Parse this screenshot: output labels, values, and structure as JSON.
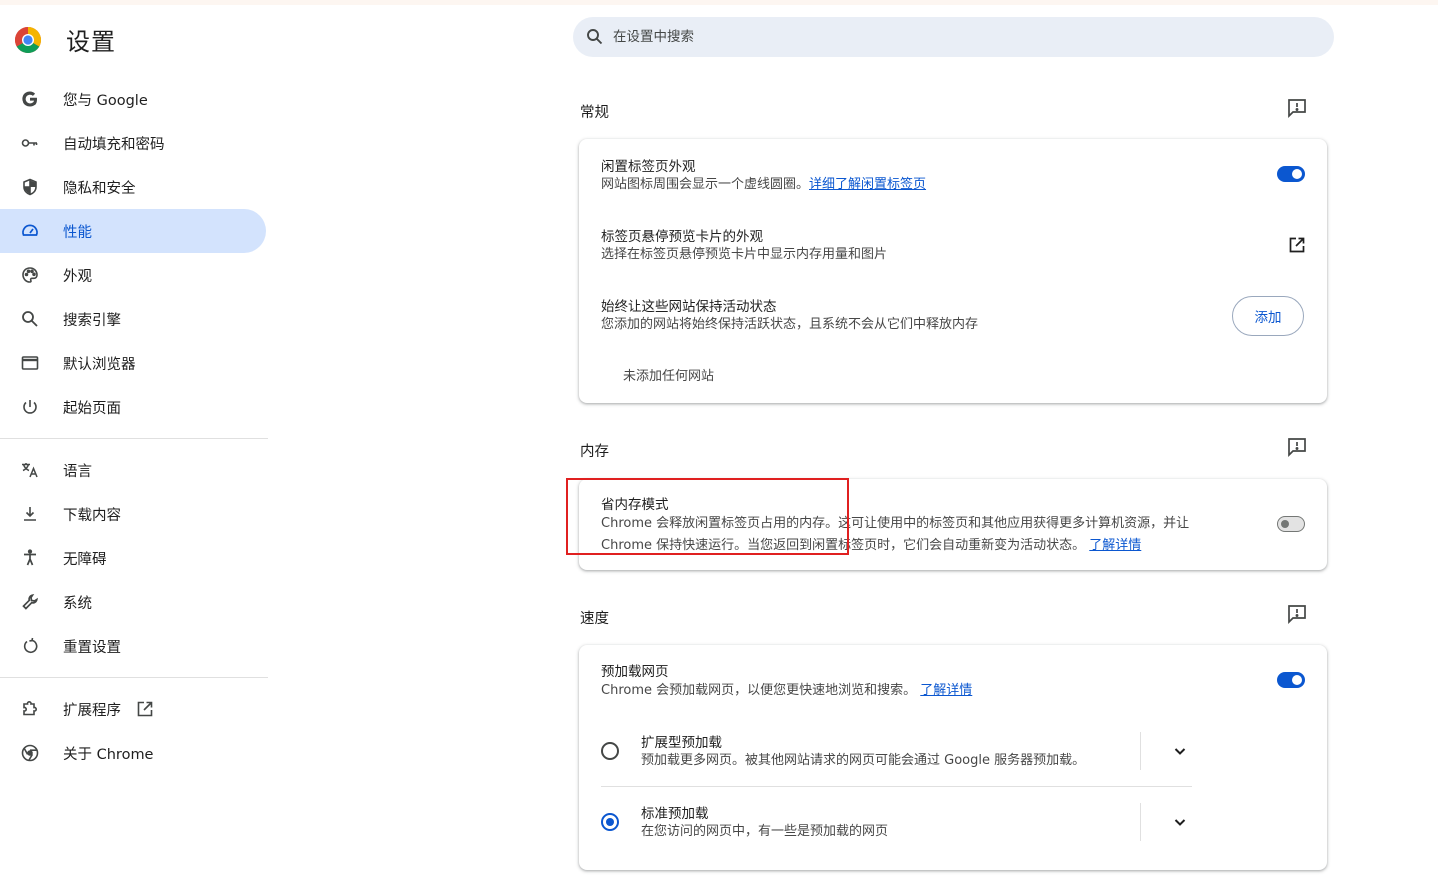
{
  "app": {
    "title": "设置"
  },
  "search": {
    "placeholder": "在设置中搜索"
  },
  "sidebar": {
    "items": [
      {
        "label": "您与 Google",
        "icon": "google-icon"
      },
      {
        "label": "自动填充和密码",
        "icon": "key-icon"
      },
      {
        "label": "隐私和安全",
        "icon": "shield-icon"
      },
      {
        "label": "性能",
        "icon": "speedometer-icon",
        "active": true
      },
      {
        "label": "外观",
        "icon": "palette-icon"
      },
      {
        "label": "搜索引擎",
        "icon": "search-icon"
      },
      {
        "label": "默认浏览器",
        "icon": "browser-window-icon"
      },
      {
        "label": "起始页面",
        "icon": "power-icon"
      },
      {
        "label": "语言",
        "icon": "translate-icon"
      },
      {
        "label": "下载内容",
        "icon": "download-icon"
      },
      {
        "label": "无障碍",
        "icon": "accessibility-icon"
      },
      {
        "label": "系统",
        "icon": "wrench-icon"
      },
      {
        "label": "重置设置",
        "icon": "reset-icon"
      },
      {
        "label": "扩展程序",
        "icon": "puzzle-icon"
      },
      {
        "label": "关于 Chrome",
        "icon": "chrome-icon"
      }
    ]
  },
  "general": {
    "title": "常规",
    "inactive_tabs": {
      "title": "闲置标签页外观",
      "desc": "网站图标周围会显示一个虚线圆圈。",
      "link": "详细了解闲置标签页",
      "enabled": true
    },
    "hover_card": {
      "title": "标签页悬停预览卡片的外观",
      "desc": "选择在标签页悬停预览卡片中显示内存用量和图片"
    },
    "keep_active": {
      "title": "始终让这些网站保持活动状态",
      "desc": "您添加的网站将始终保持活跃状态，且系统不会从它们中释放内存",
      "button": "添加",
      "empty": "未添加任何网站"
    }
  },
  "memory": {
    "title": "内存",
    "saver": {
      "title": "省内存模式",
      "desc_line1": "Chrome 会释放闲置标签页占用的内存。这可让使用中的标签页和其他应用获得更多计算机资源，并让",
      "desc_line2": "Chrome 保持快速运行。当您返回到闲置标签页时，它们会自动重新变为活动状态。",
      "link": "了解详情",
      "enabled": false
    }
  },
  "speed": {
    "title": "速度",
    "preload": {
      "title": "预加载网页",
      "desc": "Chrome 会预加载网页，以便您更快速地浏览和搜索。",
      "link": "了解详情",
      "enabled": true
    },
    "options": [
      {
        "title": "扩展型预加载",
        "desc": "预加载更多网页。被其他网站请求的网页可能会通过 Google 服务器预加载。",
        "selected": false
      },
      {
        "title": "标准预加载",
        "desc": "在您访问的网页中，有一些是预加载的网页",
        "selected": true
      }
    ]
  },
  "colors": {
    "accent": "#0b57d0",
    "active_nav_bg": "#d3e3fd",
    "highlight_box": "#e02020"
  }
}
